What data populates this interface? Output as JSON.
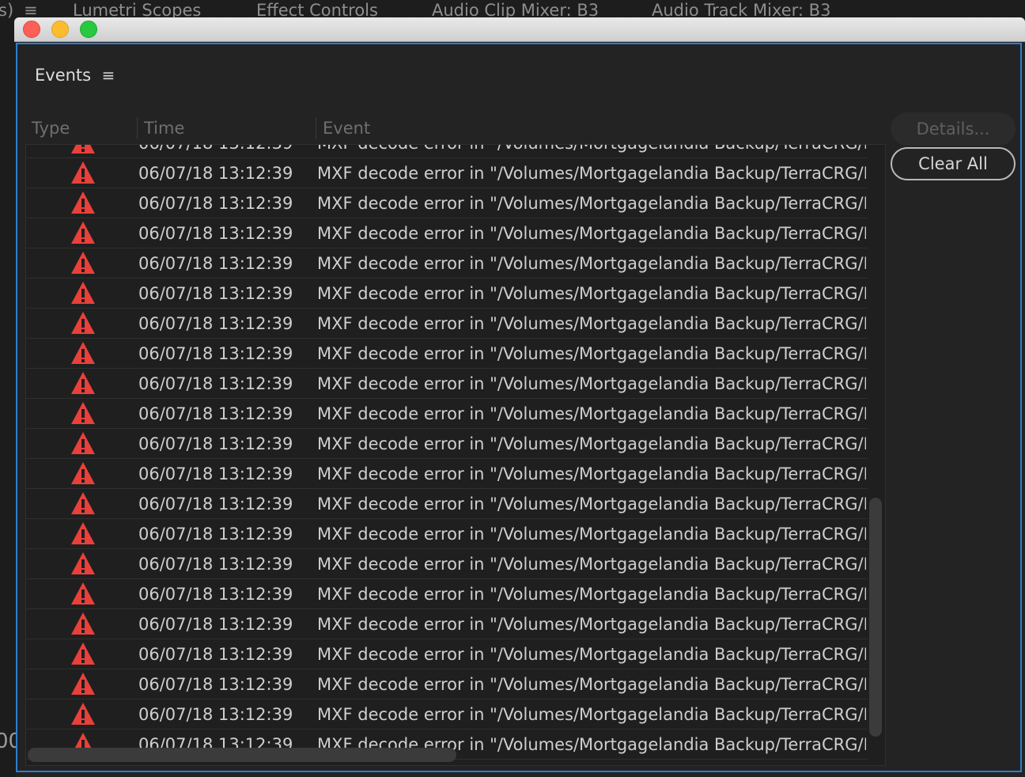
{
  "background_tabs": {
    "fragment_left": "s)",
    "menu_glyph": "≡",
    "tabs": [
      "Lumetri Scopes",
      "Effect Controls",
      "Audio Clip Mixer: B3",
      "Audio Track Mixer: B3"
    ],
    "left_fragment": "00"
  },
  "panel": {
    "title": "Events",
    "menu_glyph": "≡"
  },
  "columns": {
    "type": "Type",
    "time": "Time",
    "event": "Event"
  },
  "buttons": {
    "details": "Details...",
    "clear_all": "Clear All"
  },
  "colors": {
    "accent_border": "#2d7fd2",
    "warning": "#e8403a"
  },
  "events": [
    {
      "type": "warning-icon",
      "time": "06/07/18 13:12:39",
      "event": "MXF decode error in \"/Volumes/Mortgagelandia Backup/TerraCRG/Med"
    },
    {
      "type": "warning-icon",
      "time": "06/07/18 13:12:39",
      "event": "MXF decode error in \"/Volumes/Mortgagelandia Backup/TerraCRG/Med"
    },
    {
      "type": "warning-icon",
      "time": "06/07/18 13:12:39",
      "event": "MXF decode error in \"/Volumes/Mortgagelandia Backup/TerraCRG/Med"
    },
    {
      "type": "warning-icon",
      "time": "06/07/18 13:12:39",
      "event": "MXF decode error in \"/Volumes/Mortgagelandia Backup/TerraCRG/Med"
    },
    {
      "type": "warning-icon",
      "time": "06/07/18 13:12:39",
      "event": "MXF decode error in \"/Volumes/Mortgagelandia Backup/TerraCRG/Med"
    },
    {
      "type": "warning-icon",
      "time": "06/07/18 13:12:39",
      "event": "MXF decode error in \"/Volumes/Mortgagelandia Backup/TerraCRG/Med"
    },
    {
      "type": "warning-icon",
      "time": "06/07/18 13:12:39",
      "event": "MXF decode error in \"/Volumes/Mortgagelandia Backup/TerraCRG/Med"
    },
    {
      "type": "warning-icon",
      "time": "06/07/18 13:12:39",
      "event": "MXF decode error in \"/Volumes/Mortgagelandia Backup/TerraCRG/Med"
    },
    {
      "type": "warning-icon",
      "time": "06/07/18 13:12:39",
      "event": "MXF decode error in \"/Volumes/Mortgagelandia Backup/TerraCRG/Med"
    },
    {
      "type": "warning-icon",
      "time": "06/07/18 13:12:39",
      "event": "MXF decode error in \"/Volumes/Mortgagelandia Backup/TerraCRG/Med"
    },
    {
      "type": "warning-icon",
      "time": "06/07/18 13:12:39",
      "event": "MXF decode error in \"/Volumes/Mortgagelandia Backup/TerraCRG/Med"
    },
    {
      "type": "warning-icon",
      "time": "06/07/18 13:12:39",
      "event": "MXF decode error in \"/Volumes/Mortgagelandia Backup/TerraCRG/Med"
    },
    {
      "type": "warning-icon",
      "time": "06/07/18 13:12:39",
      "event": "MXF decode error in \"/Volumes/Mortgagelandia Backup/TerraCRG/Med"
    },
    {
      "type": "warning-icon",
      "time": "06/07/18 13:12:39",
      "event": "MXF decode error in \"/Volumes/Mortgagelandia Backup/TerraCRG/Med"
    },
    {
      "type": "warning-icon",
      "time": "06/07/18 13:12:39",
      "event": "MXF decode error in \"/Volumes/Mortgagelandia Backup/TerraCRG/Med"
    },
    {
      "type": "warning-icon",
      "time": "06/07/18 13:12:39",
      "event": "MXF decode error in \"/Volumes/Mortgagelandia Backup/TerraCRG/Med"
    },
    {
      "type": "warning-icon",
      "time": "06/07/18 13:12:39",
      "event": "MXF decode error in \"/Volumes/Mortgagelandia Backup/TerraCRG/Med"
    },
    {
      "type": "warning-icon",
      "time": "06/07/18 13:12:39",
      "event": "MXF decode error in \"/Volumes/Mortgagelandia Backup/TerraCRG/Med"
    },
    {
      "type": "warning-icon",
      "time": "06/07/18 13:12:39",
      "event": "MXF decode error in \"/Volumes/Mortgagelandia Backup/TerraCRG/Med"
    },
    {
      "type": "warning-icon",
      "time": "06/07/18 13:12:39",
      "event": "MXF decode error in \"/Volumes/Mortgagelandia Backup/TerraCRG/Med"
    },
    {
      "type": "warning-icon",
      "time": "06/07/18 13:12:39",
      "event": "MXF decode error in \"/Volumes/Mortgagelandia Backup/TerraCRG/Med"
    }
  ]
}
